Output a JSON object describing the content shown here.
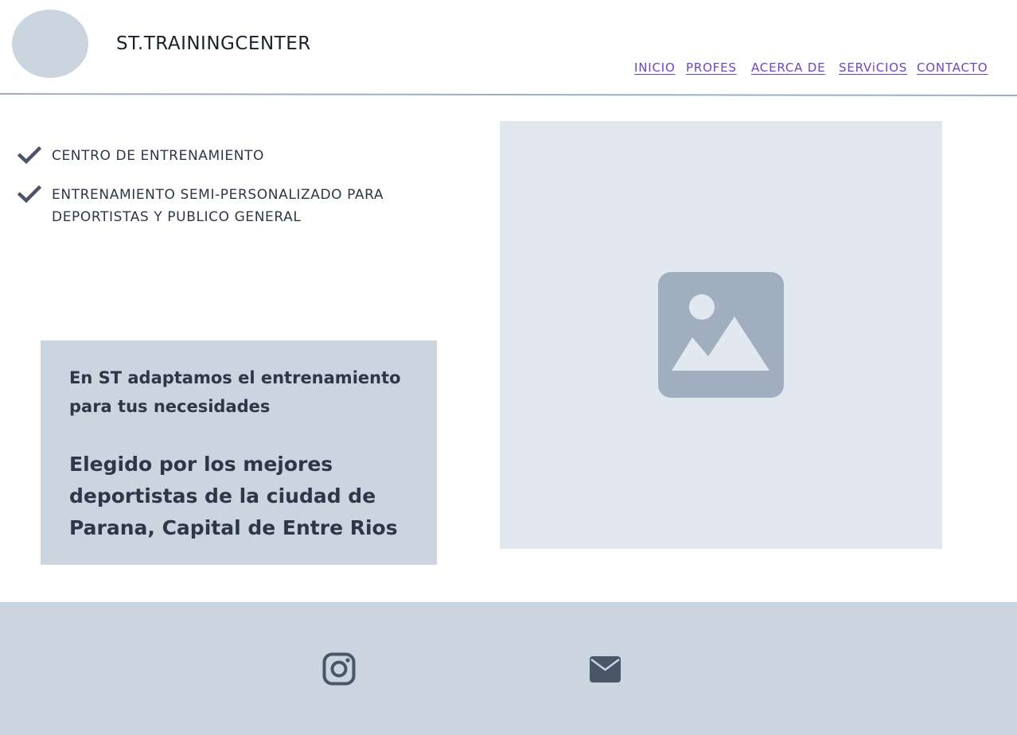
{
  "header": {
    "brand": "ST.TRAININGCENTER",
    "nav": [
      "INICIO",
      "PROFES",
      "ACERCA DE ",
      "SERViCIOS",
      "CONTACTO"
    ]
  },
  "features": [
    "CENTRO DE ENTRENAMIENTO",
    "ENTRENAMIENTO SEMI-PERSONALIZADO PARA DEPORTISTAS Y PUBLICO GENERAL"
  ],
  "info": {
    "tagline": "En ST adaptamos el entrenamiento para tus necesidades",
    "highlight": "Elegido por los mejores deportistas de la ciudad de Parana, Capital de Entre Rios"
  },
  "icons": {
    "check": "check-icon",
    "image": "image-icon",
    "instagram": "instagram-icon",
    "mail": "mail-icon"
  },
  "colors": {
    "nav_link": "#6b46c1",
    "panel": "#cbd5e0",
    "placeholder": "#e2e8f0",
    "icon": "#4a5568",
    "text": "#2d3748"
  }
}
